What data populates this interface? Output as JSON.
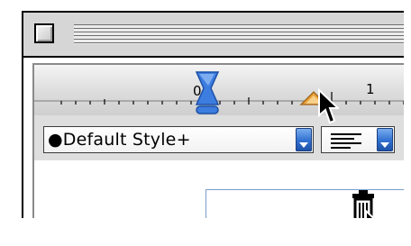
{
  "window": {
    "close_box_icon": "close-box-icon",
    "title": ""
  },
  "ruler": {
    "labels": [
      "0",
      "1"
    ],
    "left_indent_marker_icon": "hourglass-indent-marker-icon",
    "tab_stop_icon": "triangle-tab-stop-icon",
    "accent_colors": {
      "indent_marker": "#3d7de0",
      "tab_stop": "#e8a33a"
    }
  },
  "toolbar": {
    "style_popup": {
      "selected_value": "●Default Style+",
      "arrow_icon": "popup-arrow-icon"
    },
    "alignment_popup": {
      "selected_icon": "left-align-icon",
      "arrow_icon": "popup-arrow-icon"
    }
  },
  "document": {
    "trash_icon": "trash-can-icon"
  },
  "cursors": {
    "ruler_cursor_icon": "arrow-cursor-icon",
    "document_cursor_icon": "arrow-cursor-icon"
  }
}
